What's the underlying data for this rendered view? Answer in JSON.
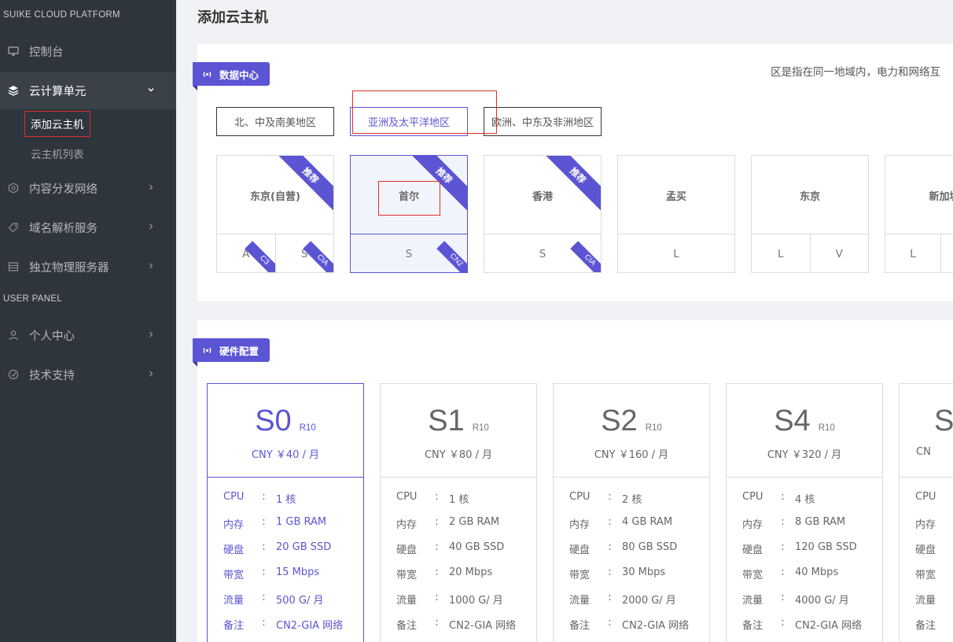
{
  "sidebar": {
    "section1": "SUIKE CLOUD PLATFORM",
    "section2": "USER PANEL",
    "items": [
      {
        "label": "控制台"
      },
      {
        "label": "云计算单元"
      },
      {
        "label": "内容分发网络"
      },
      {
        "label": "域名解析服务"
      },
      {
        "label": "独立物理服务器"
      },
      {
        "label": "个人中心"
      },
      {
        "label": "技术支持"
      }
    ],
    "subitems": [
      {
        "label": "添加云主机"
      },
      {
        "label": "云主机列表"
      }
    ]
  },
  "page": {
    "title": "添加云主机"
  },
  "datacenter": {
    "badge": "数据中心",
    "hint": "区是指在同一地域内，电力和网络互",
    "regions": [
      {
        "label": "北、中及南美地区"
      },
      {
        "label": "亚洲及太平洋地区"
      },
      {
        "label": "欧洲、中东及非洲地区"
      }
    ],
    "cards": [
      {
        "name": "东京(自营)",
        "ribbon": "推荐",
        "cells": [
          {
            "label": "A",
            "tag": "C3"
          },
          {
            "label": "S",
            "tag": "CIA"
          }
        ]
      },
      {
        "name": "首尔",
        "ribbon": "推荐",
        "cells": [
          {
            "label": "S",
            "tag": "CN2"
          }
        ]
      },
      {
        "name": "香港",
        "ribbon": "推荐",
        "cells": [
          {
            "label": "S",
            "tag": "CIA"
          }
        ]
      },
      {
        "name": "孟买",
        "cells": [
          {
            "label": "L"
          }
        ]
      },
      {
        "name": "东京",
        "cells": [
          {
            "label": "L"
          },
          {
            "label": "V"
          }
        ]
      },
      {
        "name": "新加坡",
        "cells": [
          {
            "label": "L"
          },
          {
            "label": ""
          }
        ]
      }
    ]
  },
  "hardware": {
    "badge": "硬件配置",
    "plans": [
      {
        "name": "S0",
        "tier": "R10",
        "price": "CNY ￥40 / 月",
        "specs": [
          {
            "k": "CPU",
            "v": "1 核"
          },
          {
            "k": "内存",
            "v": "1 GB RAM"
          },
          {
            "k": "硬盘",
            "v": "20 GB SSD"
          },
          {
            "k": "带宽",
            "v": "15 Mbps"
          },
          {
            "k": "流量",
            "v": "500 G/ 月"
          },
          {
            "k": "备注",
            "v": "CN2-GIA 网络"
          }
        ]
      },
      {
        "name": "S1",
        "tier": "R10",
        "price": "CNY ￥80 / 月",
        "specs": [
          {
            "k": "CPU",
            "v": "1 核"
          },
          {
            "k": "内存",
            "v": "2 GB RAM"
          },
          {
            "k": "硬盘",
            "v": "40 GB SSD"
          },
          {
            "k": "带宽",
            "v": "20 Mbps"
          },
          {
            "k": "流量",
            "v": "1000 G/ 月"
          },
          {
            "k": "备注",
            "v": "CN2-GIA 网络"
          }
        ]
      },
      {
        "name": "S2",
        "tier": "R10",
        "price": "CNY ￥160 / 月",
        "specs": [
          {
            "k": "CPU",
            "v": "2 核"
          },
          {
            "k": "内存",
            "v": "4 GB RAM"
          },
          {
            "k": "硬盘",
            "v": "80 GB SSD"
          },
          {
            "k": "带宽",
            "v": "30 Mbps"
          },
          {
            "k": "流量",
            "v": "2000 G/ 月"
          },
          {
            "k": "备注",
            "v": "CN2-GIA 网络"
          }
        ]
      },
      {
        "name": "S4",
        "tier": "R10",
        "price": "CNY ￥320 / 月",
        "specs": [
          {
            "k": "CPU",
            "v": "4 核"
          },
          {
            "k": "内存",
            "v": "8 GB RAM"
          },
          {
            "k": "硬盘",
            "v": "120 GB SSD"
          },
          {
            "k": "带宽",
            "v": "40 Mbps"
          },
          {
            "k": "流量",
            "v": "4000 G/ 月"
          },
          {
            "k": "备注",
            "v": "CN2-GIA 网络"
          }
        ]
      },
      {
        "name": "S",
        "tier": "",
        "price": "CN",
        "specs": [
          {
            "k": "CPU",
            "v": ""
          },
          {
            "k": "内存",
            "v": ""
          },
          {
            "k": "硬盘",
            "v": ""
          },
          {
            "k": "带宽",
            "v": ""
          },
          {
            "k": "流量",
            "v": ""
          },
          {
            "k": "备注",
            "v": ""
          }
        ]
      }
    ]
  }
}
